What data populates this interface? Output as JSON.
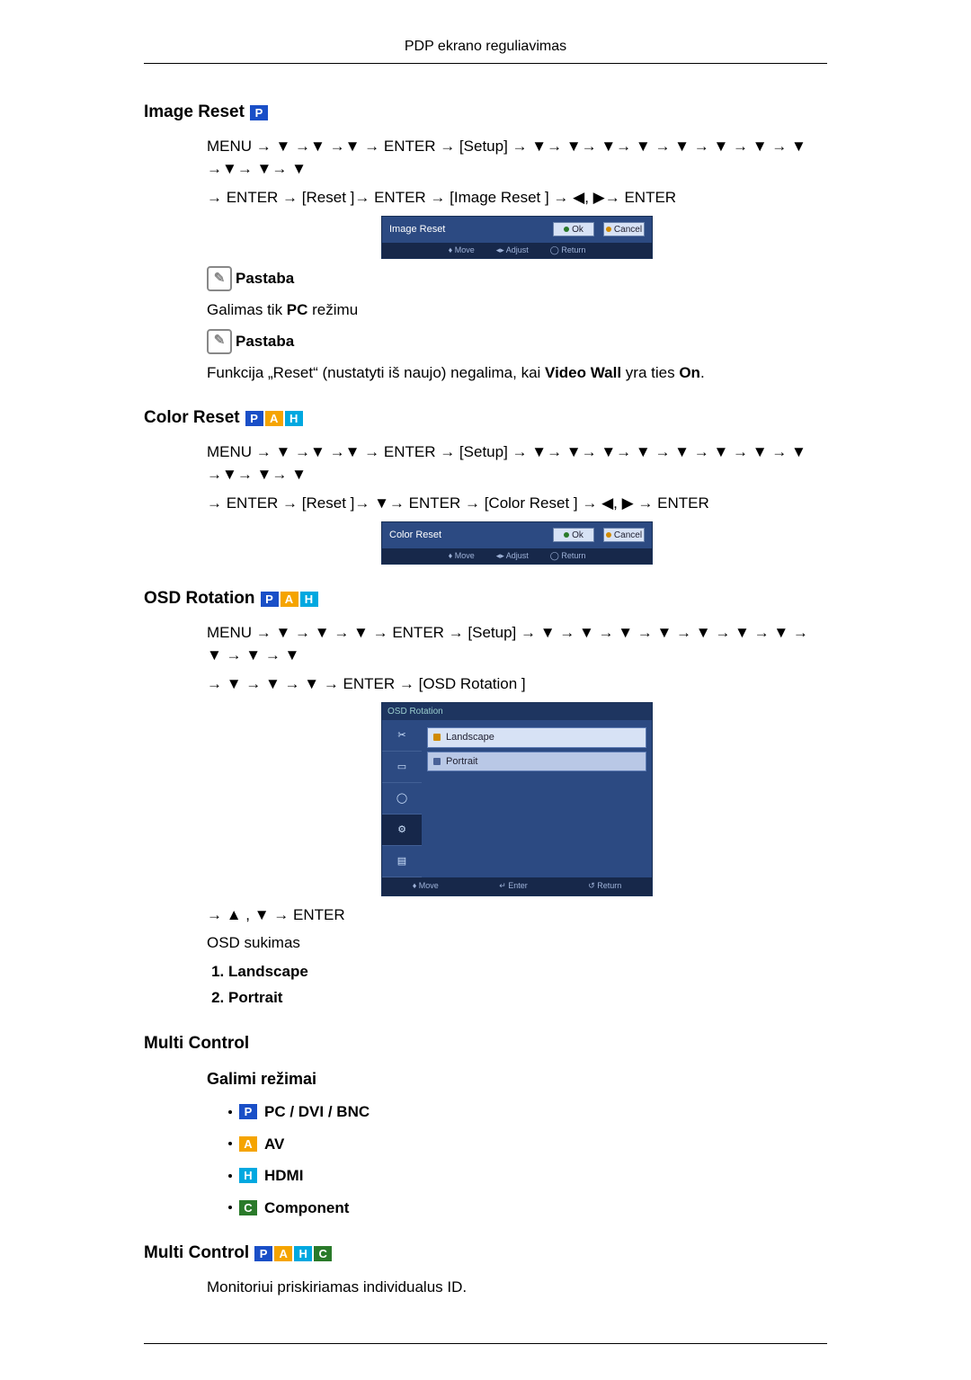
{
  "header": {
    "title": "PDP ekrano reguliavimas"
  },
  "sections": {
    "imageReset": {
      "title": "Image Reset",
      "nav1": "MENU → ▼ →▼ →▼ → ENTER → [Setup] → ▼→ ▼→ ▼→ ▼ → ▼ → ▼ → ▼ → ▼ →▼→ ▼→ ▼",
      "nav2": "→ ENTER → [Reset ]→ ENTER → [Image Reset ] → ◀, ▶→ ENTER",
      "dialog": {
        "title": "Image Reset",
        "ok": "Ok",
        "cancel": "Cancel",
        "hintMove": "Move",
        "hintAdjust": "Adjust",
        "hintReturn": "Return"
      },
      "note1Label": "Pastaba",
      "note1Text": "Galimas tik PC režimu",
      "note2Label": "Pastaba",
      "note2Text": "Funkcija „Reset\" (nustatyti iš naujo) negalima, kai Video Wall yra ties On."
    },
    "colorReset": {
      "title": "Color Reset",
      "nav1": "MENU → ▼ →▼ →▼ → ENTER → [Setup] → ▼→ ▼→ ▼→ ▼ → ▼ → ▼ → ▼ → ▼ →▼→ ▼→ ▼",
      "nav2": "→ ENTER → [Reset ]→ ▼→ ENTER → [Color Reset ] → ◀, ▶ → ENTER",
      "dialog": {
        "title": "Color Reset",
        "ok": "Ok",
        "cancel": "Cancel",
        "hintMove": "Move",
        "hintAdjust": "Adjust",
        "hintReturn": "Return"
      }
    },
    "osdRotation": {
      "title": "OSD Rotation",
      "nav1": "MENU → ▼ → ▼ → ▼ → ENTER → [Setup] → ▼ → ▼ → ▼ → ▼ → ▼ → ▼ → ▼ → ▼ → ▼ → ▼",
      "nav2": "→ ▼ → ▼ → ▼ → ENTER → [OSD Rotation ]",
      "dialog": {
        "title": "OSD Rotation",
        "opt1": "Landscape",
        "opt2": "Portrait",
        "hintMove": "Move",
        "hintEnter": "Enter",
        "hintReturn": "Return"
      },
      "nav3": "→ ▲ , ▼ → ENTER",
      "desc": "OSD sukimas",
      "list": {
        "i1": "Landscape",
        "i2": "Portrait"
      }
    },
    "multiControlHeader": {
      "title": "Multi Control"
    },
    "modesHeader": {
      "title": "Galimi režimai"
    },
    "modes": {
      "pc": "PC / DVI / BNC",
      "av": "AV",
      "hdmi": "HDMI",
      "component": "Component"
    },
    "multiControl2": {
      "title": "Multi Control",
      "text": "Monitoriui priskiriamas individualus ID."
    }
  },
  "badges": {
    "P": "P",
    "A": "A",
    "H": "H",
    "C": "C"
  }
}
